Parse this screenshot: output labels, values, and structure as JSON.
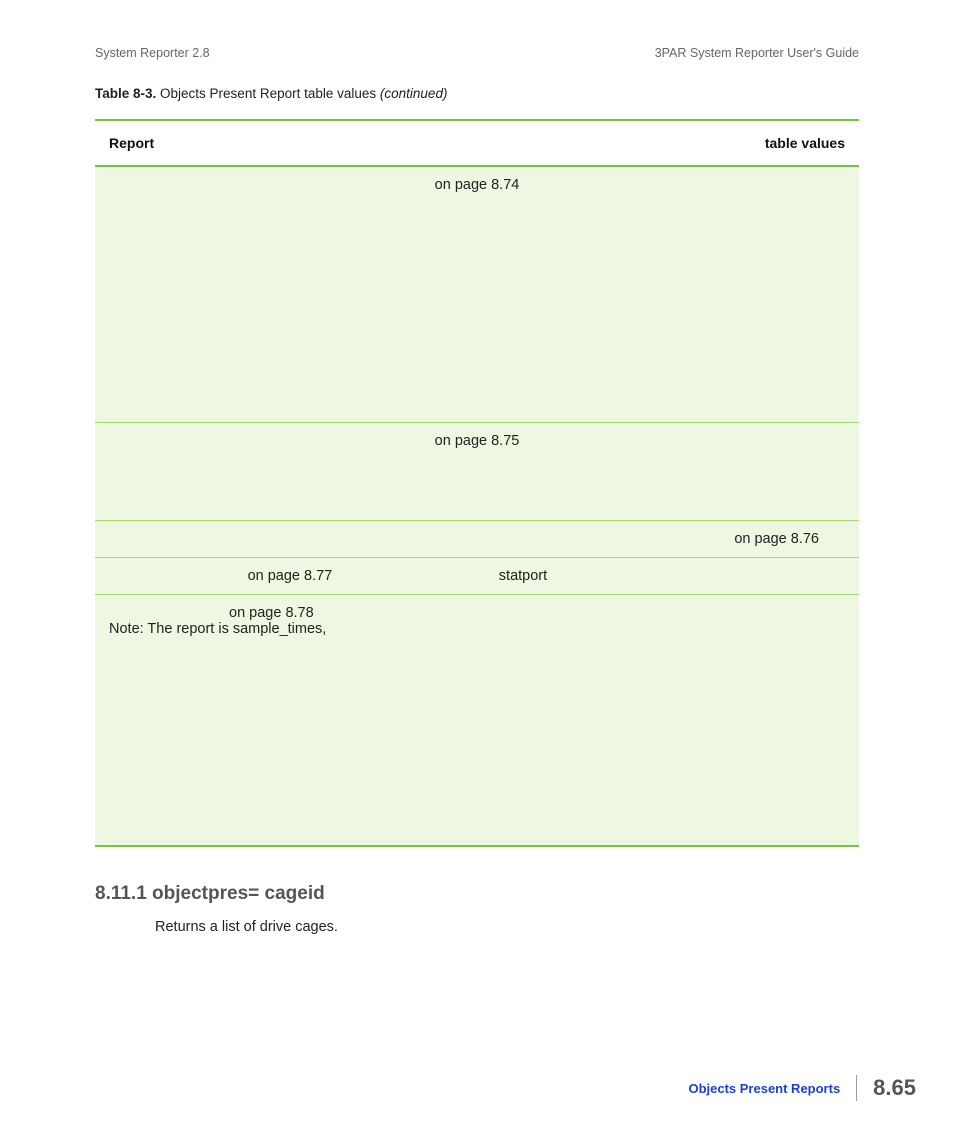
{
  "header": {
    "left": "System Reporter 2.8",
    "right": "3PAR System Reporter User's Guide"
  },
  "table": {
    "caption_label": "Table 8-3.",
    "caption_text": "  Objects Present Report table values ",
    "caption_suffix": "(continued)",
    "head_left": "Report",
    "head_right": "table values",
    "rows": {
      "r1c1": "on page 8.74",
      "r2c1": "on page 8.75",
      "r3c1": "on page 8.76",
      "r4c1": "on page 8.77",
      "r4c2": "statport",
      "r5_line1": "on page 8.78",
      "r5_line2": "Note: The report is sample_times,"
    }
  },
  "section": {
    "heading": "8.11.1 objectpres= cageid",
    "body": "Returns a list of drive cages."
  },
  "footer": {
    "label": "Objects Present Reports",
    "page": "8.65"
  }
}
